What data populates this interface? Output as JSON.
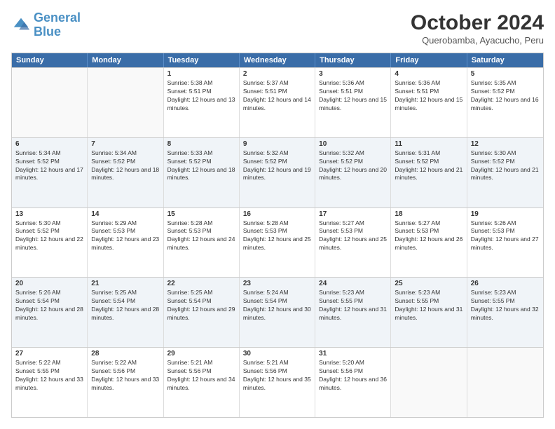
{
  "logo": {
    "line1": "General",
    "line2": "Blue"
  },
  "title": "October 2024",
  "subtitle": "Querobamba, Ayacucho, Peru",
  "days_of_week": [
    "Sunday",
    "Monday",
    "Tuesday",
    "Wednesday",
    "Thursday",
    "Friday",
    "Saturday"
  ],
  "weeks": [
    [
      {
        "day": "",
        "info": ""
      },
      {
        "day": "",
        "info": ""
      },
      {
        "day": "1",
        "info": "Sunrise: 5:38 AM\nSunset: 5:51 PM\nDaylight: 12 hours and 13 minutes."
      },
      {
        "day": "2",
        "info": "Sunrise: 5:37 AM\nSunset: 5:51 PM\nDaylight: 12 hours and 14 minutes."
      },
      {
        "day": "3",
        "info": "Sunrise: 5:36 AM\nSunset: 5:51 PM\nDaylight: 12 hours and 15 minutes."
      },
      {
        "day": "4",
        "info": "Sunrise: 5:36 AM\nSunset: 5:51 PM\nDaylight: 12 hours and 15 minutes."
      },
      {
        "day": "5",
        "info": "Sunrise: 5:35 AM\nSunset: 5:52 PM\nDaylight: 12 hours and 16 minutes."
      }
    ],
    [
      {
        "day": "6",
        "info": "Sunrise: 5:34 AM\nSunset: 5:52 PM\nDaylight: 12 hours and 17 minutes."
      },
      {
        "day": "7",
        "info": "Sunrise: 5:34 AM\nSunset: 5:52 PM\nDaylight: 12 hours and 18 minutes."
      },
      {
        "day": "8",
        "info": "Sunrise: 5:33 AM\nSunset: 5:52 PM\nDaylight: 12 hours and 18 minutes."
      },
      {
        "day": "9",
        "info": "Sunrise: 5:32 AM\nSunset: 5:52 PM\nDaylight: 12 hours and 19 minutes."
      },
      {
        "day": "10",
        "info": "Sunrise: 5:32 AM\nSunset: 5:52 PM\nDaylight: 12 hours and 20 minutes."
      },
      {
        "day": "11",
        "info": "Sunrise: 5:31 AM\nSunset: 5:52 PM\nDaylight: 12 hours and 21 minutes."
      },
      {
        "day": "12",
        "info": "Sunrise: 5:30 AM\nSunset: 5:52 PM\nDaylight: 12 hours and 21 minutes."
      }
    ],
    [
      {
        "day": "13",
        "info": "Sunrise: 5:30 AM\nSunset: 5:52 PM\nDaylight: 12 hours and 22 minutes."
      },
      {
        "day": "14",
        "info": "Sunrise: 5:29 AM\nSunset: 5:53 PM\nDaylight: 12 hours and 23 minutes."
      },
      {
        "day": "15",
        "info": "Sunrise: 5:28 AM\nSunset: 5:53 PM\nDaylight: 12 hours and 24 minutes."
      },
      {
        "day": "16",
        "info": "Sunrise: 5:28 AM\nSunset: 5:53 PM\nDaylight: 12 hours and 25 minutes."
      },
      {
        "day": "17",
        "info": "Sunrise: 5:27 AM\nSunset: 5:53 PM\nDaylight: 12 hours and 25 minutes."
      },
      {
        "day": "18",
        "info": "Sunrise: 5:27 AM\nSunset: 5:53 PM\nDaylight: 12 hours and 26 minutes."
      },
      {
        "day": "19",
        "info": "Sunrise: 5:26 AM\nSunset: 5:53 PM\nDaylight: 12 hours and 27 minutes."
      }
    ],
    [
      {
        "day": "20",
        "info": "Sunrise: 5:26 AM\nSunset: 5:54 PM\nDaylight: 12 hours and 28 minutes."
      },
      {
        "day": "21",
        "info": "Sunrise: 5:25 AM\nSunset: 5:54 PM\nDaylight: 12 hours and 28 minutes."
      },
      {
        "day": "22",
        "info": "Sunrise: 5:25 AM\nSunset: 5:54 PM\nDaylight: 12 hours and 29 minutes."
      },
      {
        "day": "23",
        "info": "Sunrise: 5:24 AM\nSunset: 5:54 PM\nDaylight: 12 hours and 30 minutes."
      },
      {
        "day": "24",
        "info": "Sunrise: 5:23 AM\nSunset: 5:55 PM\nDaylight: 12 hours and 31 minutes."
      },
      {
        "day": "25",
        "info": "Sunrise: 5:23 AM\nSunset: 5:55 PM\nDaylight: 12 hours and 31 minutes."
      },
      {
        "day": "26",
        "info": "Sunrise: 5:23 AM\nSunset: 5:55 PM\nDaylight: 12 hours and 32 minutes."
      }
    ],
    [
      {
        "day": "27",
        "info": "Sunrise: 5:22 AM\nSunset: 5:55 PM\nDaylight: 12 hours and 33 minutes."
      },
      {
        "day": "28",
        "info": "Sunrise: 5:22 AM\nSunset: 5:56 PM\nDaylight: 12 hours and 33 minutes."
      },
      {
        "day": "29",
        "info": "Sunrise: 5:21 AM\nSunset: 5:56 PM\nDaylight: 12 hours and 34 minutes."
      },
      {
        "day": "30",
        "info": "Sunrise: 5:21 AM\nSunset: 5:56 PM\nDaylight: 12 hours and 35 minutes."
      },
      {
        "day": "31",
        "info": "Sunrise: 5:20 AM\nSunset: 5:56 PM\nDaylight: 12 hours and 36 minutes."
      },
      {
        "day": "",
        "info": ""
      },
      {
        "day": "",
        "info": ""
      }
    ]
  ]
}
